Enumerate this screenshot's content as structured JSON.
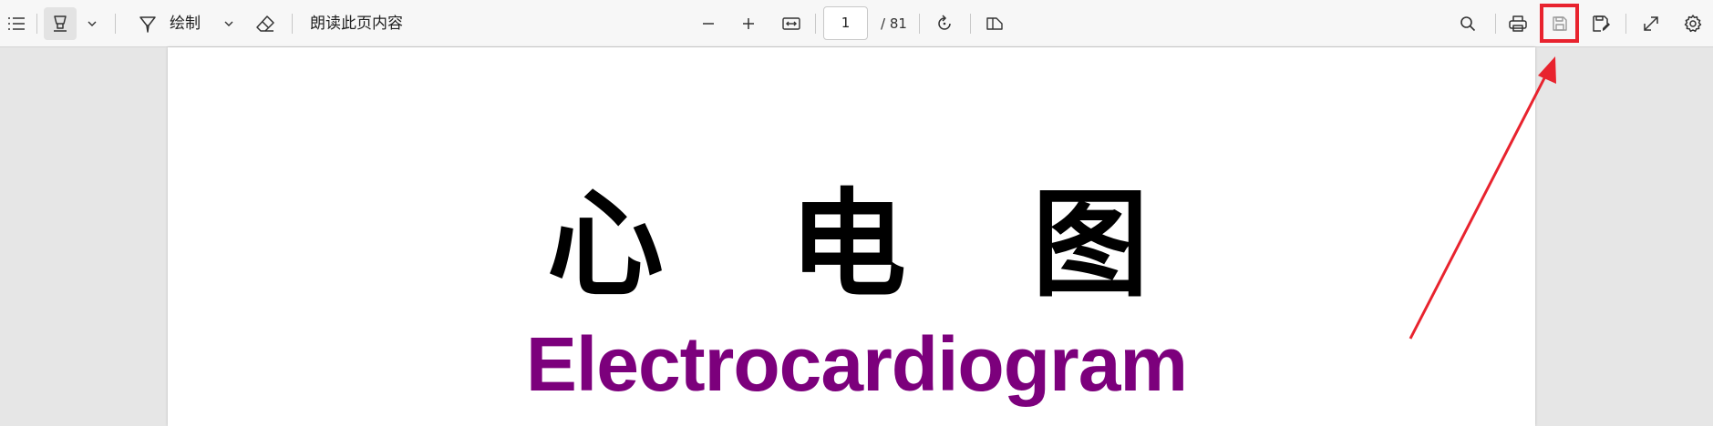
{
  "toolbar": {
    "contents_icon": "list-icon",
    "highlight_icon": "highlighter-icon",
    "draw_icon": "pen-icon",
    "draw_label": "绘制",
    "erase_icon": "eraser-icon",
    "read_aloud_label": "朗读此页内容",
    "zoom_out_icon": "minus-icon",
    "zoom_in_icon": "plus-icon",
    "fit_width_icon": "fit-width-icon",
    "current_page": "1",
    "total_pages": "/ 81",
    "rotate_icon": "rotate-icon",
    "page_view_icon": "page-view-icon",
    "search_icon": "search-icon",
    "print_icon": "printer-icon",
    "save_icon": "save-icon",
    "save_as_icon": "save-as-icon",
    "fullscreen_icon": "expand-icon",
    "settings_icon": "gear-icon"
  },
  "annotation": {
    "color": "#e8232e"
  },
  "document": {
    "title_zh": [
      "心",
      "电",
      "图"
    ],
    "title_en": "Electrocardiogram",
    "title_en_color": "#7c007c"
  }
}
